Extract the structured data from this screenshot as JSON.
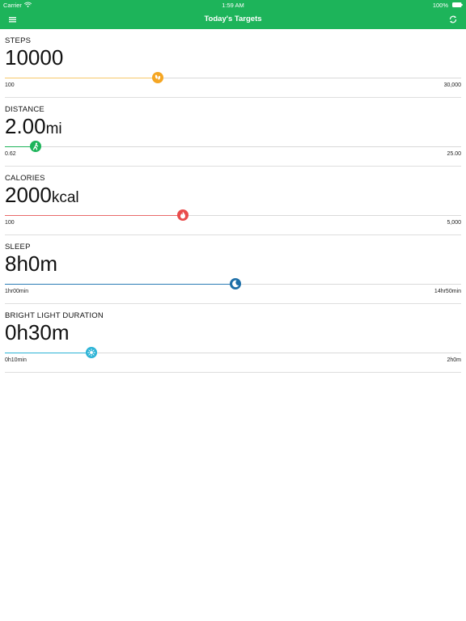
{
  "status_bar": {
    "carrier": "Carrier",
    "time": "1:59 AM",
    "battery": "100%"
  },
  "nav": {
    "title": "Today's Targets"
  },
  "targets": [
    {
      "id": "steps",
      "label": "STEPS",
      "value": "10000",
      "unit": "",
      "min": "100",
      "max": "30,000",
      "fraction": 0.335,
      "color": "#f5a623",
      "fill_color": "#f7c86a",
      "icon": "footsteps-icon"
    },
    {
      "id": "distance",
      "label": "DISTANCE",
      "value": "2.00",
      "unit": "mi",
      "min": "0.62",
      "max": "25.00",
      "fraction": 0.068,
      "color": "#1db45a",
      "fill_color": "#1db45a",
      "icon": "walker-icon"
    },
    {
      "id": "calories",
      "label": "CALORIES",
      "value": "2000",
      "unit": "kcal",
      "min": "100",
      "max": "5,000",
      "fraction": 0.39,
      "color": "#e94b4b",
      "fill_color": "#e96b6b",
      "icon": "flame-icon"
    },
    {
      "id": "sleep",
      "label": "SLEEP",
      "value": "8h0m",
      "unit": "",
      "min": "1hr00min",
      "max": "14hr50min",
      "fraction": 0.505,
      "color": "#1e6fa8",
      "fill_color": "#2a7bb4",
      "icon": "moon-icon"
    },
    {
      "id": "bright_light",
      "label": "BRIGHT LIGHT DURATION",
      "value": "0h30m",
      "unit": "",
      "min": "0h10min",
      "max": "2h0m",
      "fraction": 0.19,
      "color": "#2bb3d6",
      "fill_color": "#2bb3d6",
      "icon": "sun-icon"
    }
  ]
}
